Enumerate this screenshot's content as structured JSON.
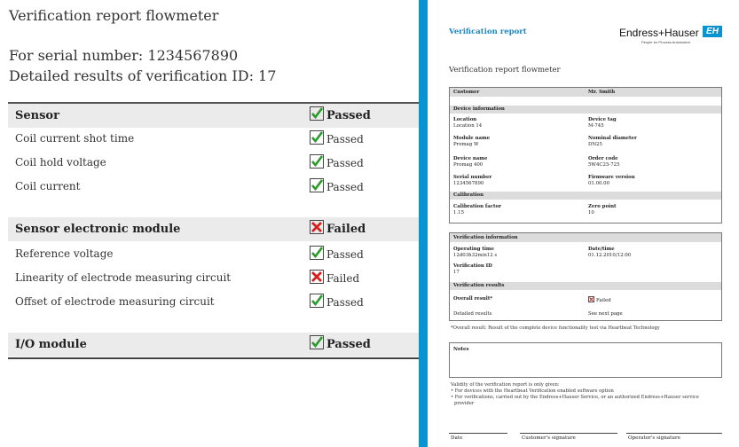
{
  "left": {
    "title": "Verification report flowmeter",
    "serial_line": "For serial number: 1234567890",
    "detail_line": "Detailed results of verification ID: 17",
    "sections": [
      {
        "name": "Sensor",
        "status": "Passed",
        "status_icon": "check-icon",
        "rows": [
          {
            "label": "Coil current shot time",
            "status": "Passed",
            "status_icon": "check-icon"
          },
          {
            "label": "Coil hold voltage",
            "status": "Passed",
            "status_icon": "check-icon"
          },
          {
            "label": "Coil current",
            "status": "Passed",
            "status_icon": "check-icon"
          }
        ]
      },
      {
        "name": "Sensor electronic module",
        "status": "Failed",
        "status_icon": "cross-icon",
        "rows": [
          {
            "label": "Reference voltage",
            "status": "Passed",
            "status_icon": "check-icon"
          },
          {
            "label": "Linearity of electrode measuring circuit",
            "status": "Failed",
            "status_icon": "cross-icon"
          },
          {
            "label": "Offset of electrode measuring circuit",
            "status": "Passed",
            "status_icon": "check-icon"
          }
        ]
      },
      {
        "name": "I/O module",
        "status": "Passed",
        "status_icon": "check-icon",
        "rows": []
      }
    ]
  },
  "report": {
    "header_title": "Verification report",
    "brand_name": "Endress+Hauser",
    "brand_tagline": "People for Process Automation",
    "brand_logo_text": "EH",
    "subtitle": "Verification report flowmeter",
    "customer_label": "Customer",
    "customer_value": "Mr. Smith",
    "device_info_label": "Device information",
    "fields_left": [
      {
        "label": "Location",
        "value": "Location 14"
      },
      {
        "label": "Module name",
        "value": "Promag W"
      },
      {
        "label": "Device name",
        "value": "Promag 400"
      },
      {
        "label": "Serial number",
        "value": "1234567890"
      }
    ],
    "fields_right": [
      {
        "label": "Device tag",
        "value": "M-745"
      },
      {
        "label": "Nominal diameter",
        "value": "DN25"
      },
      {
        "label": "Order code",
        "value": "5W4C25-725"
      },
      {
        "label": "Firmware version",
        "value": "01.00.00"
      }
    ],
    "calibration_label": "Calibration",
    "calibration_factor_label": "Calibration factor",
    "calibration_factor_value": "1.15",
    "zero_point_label": "Zero point",
    "zero_point_value": "10",
    "verification_info_label": "Verification information",
    "operating_time_label": "Operating time",
    "operating_time_value": "12d03h32min12 s",
    "date_time_label": "Date/time",
    "date_time_value": "01.12.2010/12:00",
    "verification_id_label": "Verification ID",
    "verification_id_value": "17",
    "verification_results_label": "Verification results",
    "overall_result_label": "Overall result*",
    "overall_result_value": "Failed",
    "detailed_results_label": "Detailed results",
    "detailed_results_value": "See next page",
    "footnote": "*Overall result: Result of the complete device functionality test via Heartbeat Technology",
    "notes_label": "Notes",
    "validity_line": "Validity of the verification report is only given:",
    "validity_bullet_1": "• For devices with the Heartbeat Verification enabled software option",
    "validity_bullet_2": "• For verifications, carried out by the Endress+Hauser Service, or an authorized Endress+Hauser service",
    "validity_bullet_2b": "provider",
    "sig_date": "Date",
    "sig_customer": "Customer's signature",
    "sig_operator": "Operator's signature"
  },
  "colors": {
    "accent_blue": "#0a93d1",
    "section_bg": "#ebebeb",
    "pass_green": "#2e9a2e",
    "fail_red": "#d62020"
  }
}
